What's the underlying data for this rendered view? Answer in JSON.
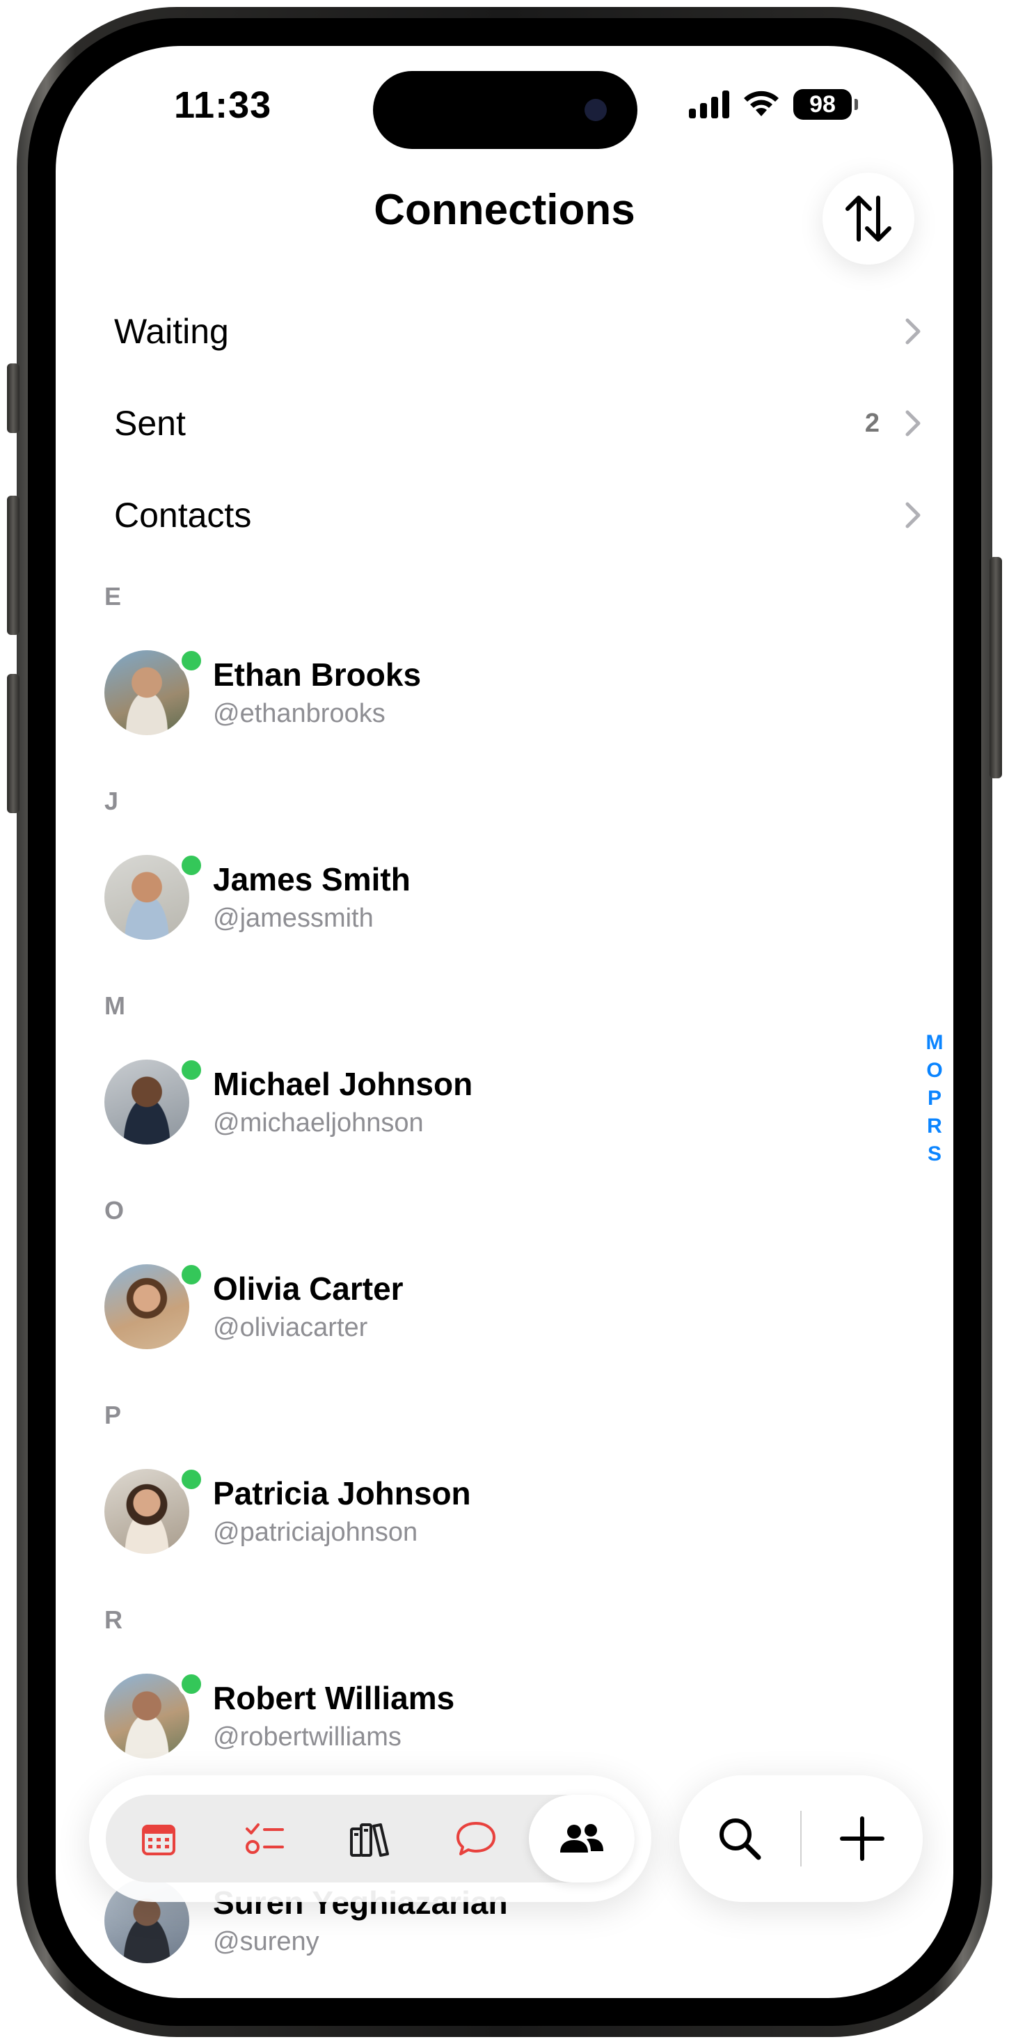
{
  "status_bar": {
    "time": "11:33",
    "battery": "98"
  },
  "header": {
    "title": "Connections",
    "sort_icon": "sort-arrows-icon"
  },
  "menu": [
    {
      "label": "Waiting",
      "count": ""
    },
    {
      "label": "Sent",
      "count": "2"
    },
    {
      "label": "Contacts",
      "count": ""
    }
  ],
  "sections": [
    {
      "letter": "E",
      "contacts": [
        {
          "name": "Ethan Brooks",
          "handle": "@ethanbrooks",
          "online": true
        }
      ]
    },
    {
      "letter": "J",
      "contacts": [
        {
          "name": "James Smith",
          "handle": "@jamessmith",
          "online": true
        }
      ]
    },
    {
      "letter": "M",
      "contacts": [
        {
          "name": "Michael Johnson",
          "handle": "@michaeljohnson",
          "online": true
        }
      ]
    },
    {
      "letter": "O",
      "contacts": [
        {
          "name": "Olivia Carter",
          "handle": "@oliviacarter",
          "online": true
        }
      ]
    },
    {
      "letter": "P",
      "contacts": [
        {
          "name": "Patricia Johnson",
          "handle": "@patriciajohnson",
          "online": true
        }
      ]
    },
    {
      "letter": "R",
      "contacts": [
        {
          "name": "Robert Williams",
          "handle": "@robertwilliams",
          "online": true
        }
      ]
    },
    {
      "letter": "",
      "contacts": [
        {
          "name": "Suren Yeghiazarian",
          "handle": "@sureny",
          "online": false
        }
      ]
    }
  ],
  "index_letters": [
    "M",
    "O",
    "P",
    "R",
    "S"
  ],
  "tab_bar": {
    "tabs": [
      {
        "icon": "calendar-icon",
        "active": false
      },
      {
        "icon": "tasks-checklist-icon",
        "active": false
      },
      {
        "icon": "library-books-icon",
        "active": false
      },
      {
        "icon": "chat-bubble-icon",
        "active": false
      },
      {
        "icon": "people-icon",
        "active": true
      }
    ],
    "actions": [
      {
        "icon": "search-icon"
      },
      {
        "icon": "plus-icon"
      }
    ]
  },
  "colors": {
    "accent_red": "#e8413d",
    "online_green": "#34c759",
    "index_blue": "#0a84ff",
    "secondary_text": "#8e8e93"
  }
}
